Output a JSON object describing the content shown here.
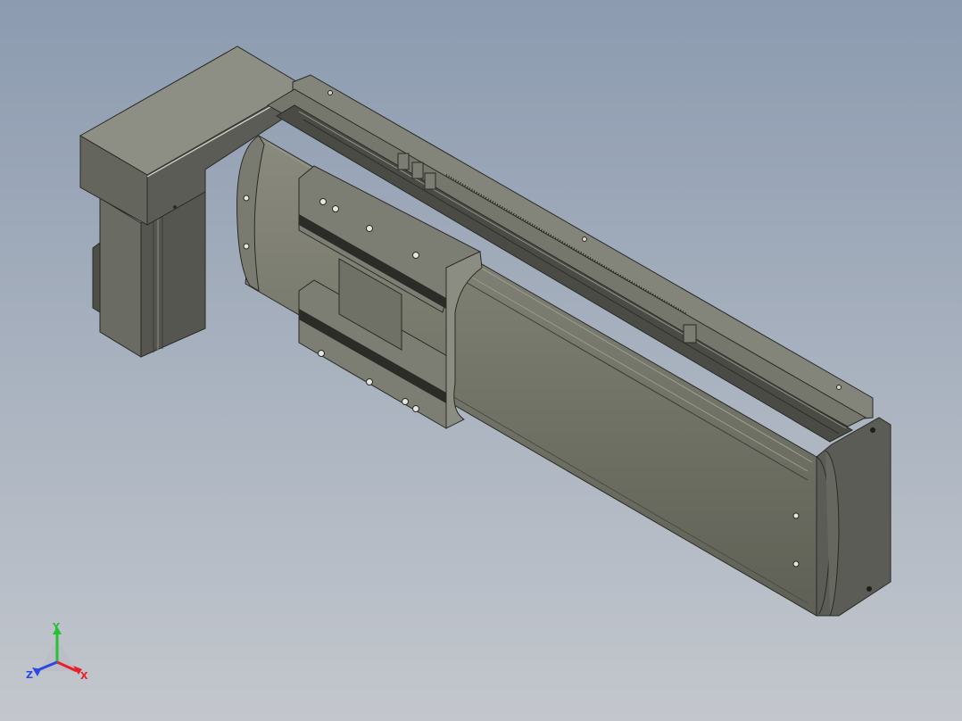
{
  "viewport": {
    "model": "linear-actuator-with-motor-housing",
    "background_top": "#8c9bb0",
    "background_bottom": "#c3c7cd",
    "model_color": "#6e6f63"
  },
  "triad": {
    "x_label": "X",
    "y_label": "Y",
    "z_label": "Z",
    "x_color": "#e8202a",
    "y_color": "#24c234",
    "z_color": "#2c48e0"
  }
}
